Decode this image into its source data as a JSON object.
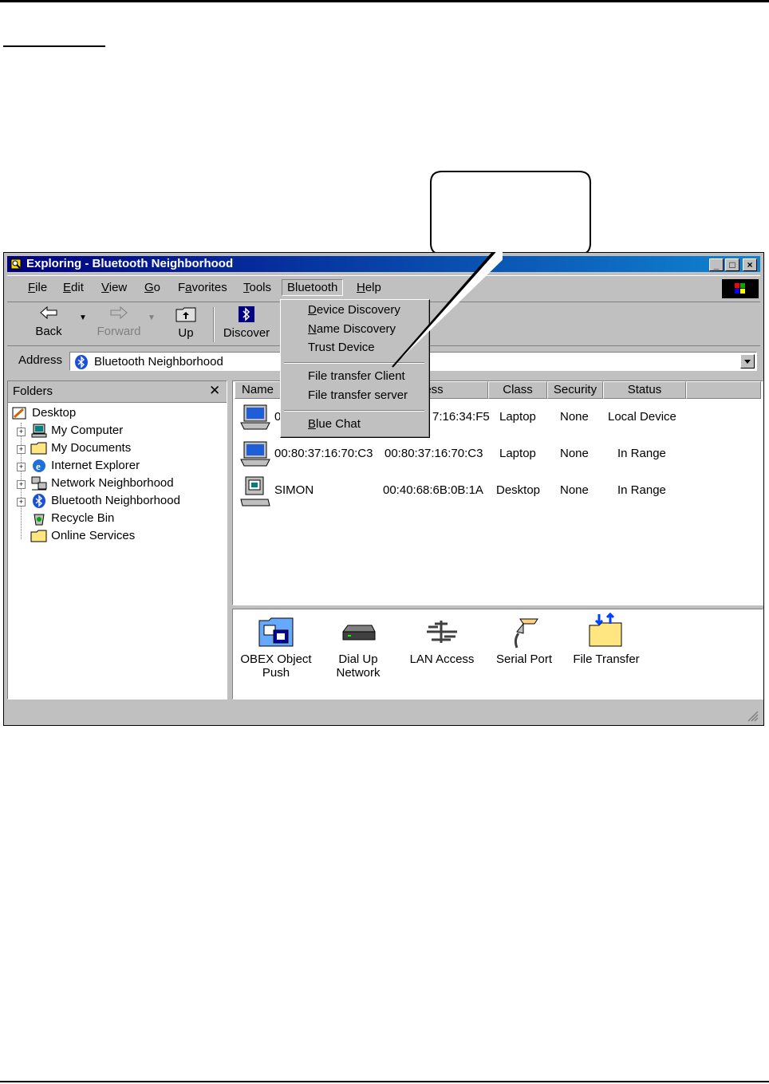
{
  "window": {
    "title": "Exploring - Bluetooth Neighborhood",
    "controls": [
      "_",
      "□",
      "×"
    ]
  },
  "menubar": {
    "items": [
      {
        "label": "File",
        "accel": "F"
      },
      {
        "label": "Edit",
        "accel": "E"
      },
      {
        "label": "View",
        "accel": "V"
      },
      {
        "label": "Go",
        "accel": "G"
      },
      {
        "label": "Favorites",
        "accel": "a"
      },
      {
        "label": "Tools",
        "accel": "T"
      },
      {
        "label": "Bluetooth",
        "accel": ""
      },
      {
        "label": "Help",
        "accel": "H"
      }
    ]
  },
  "bluetooth_menu": {
    "items": [
      "Device Discovery",
      "Name Discovery",
      "Trust Device",
      "File transfer Client",
      "File transfer server",
      "Blue Chat"
    ]
  },
  "toolbar": {
    "back": "Back",
    "forward": "Forward",
    "up": "Up",
    "discover": "Discover"
  },
  "address": {
    "label": "Address",
    "value": "Bluetooth Neighborhood"
  },
  "folders": {
    "title": "Folders",
    "close": "✕",
    "tree": [
      "Desktop",
      "My Computer",
      "My Documents",
      "Internet Explorer",
      "Network Neighborhood",
      "Bluetooth Neighborhood",
      "Recycle Bin",
      "Online Services"
    ]
  },
  "list": {
    "columns": [
      "Name",
      "Address",
      "Class",
      "Security",
      "Status"
    ],
    "rows": [
      {
        "name": "0",
        "address": "7:16:34:F5",
        "class": "Laptop",
        "security": "None",
        "status": "Local Device"
      },
      {
        "name": "00:80:37:16:70:C3",
        "address": "00:80:37:16:70:C3",
        "class": "Laptop",
        "security": "None",
        "status": "In Range"
      },
      {
        "name": "SIMON",
        "address": "00:40:68:6B:0B:1A",
        "class": "Desktop",
        "security": "None",
        "status": "In Range"
      }
    ],
    "header_address_visible": "dress"
  },
  "services": [
    {
      "line1": "OBEX Object",
      "line2": "Push",
      "icon": "obex-icon"
    },
    {
      "line1": "Dial Up",
      "line2": "Network",
      "icon": "modem-icon"
    },
    {
      "line1": "LAN Access",
      "line2": "",
      "icon": "lan-icon"
    },
    {
      "line1": "Serial Port",
      "line2": "",
      "icon": "serial-icon"
    },
    {
      "line1": "File Transfer",
      "line2": "",
      "icon": "folder-transfer-icon"
    }
  ]
}
